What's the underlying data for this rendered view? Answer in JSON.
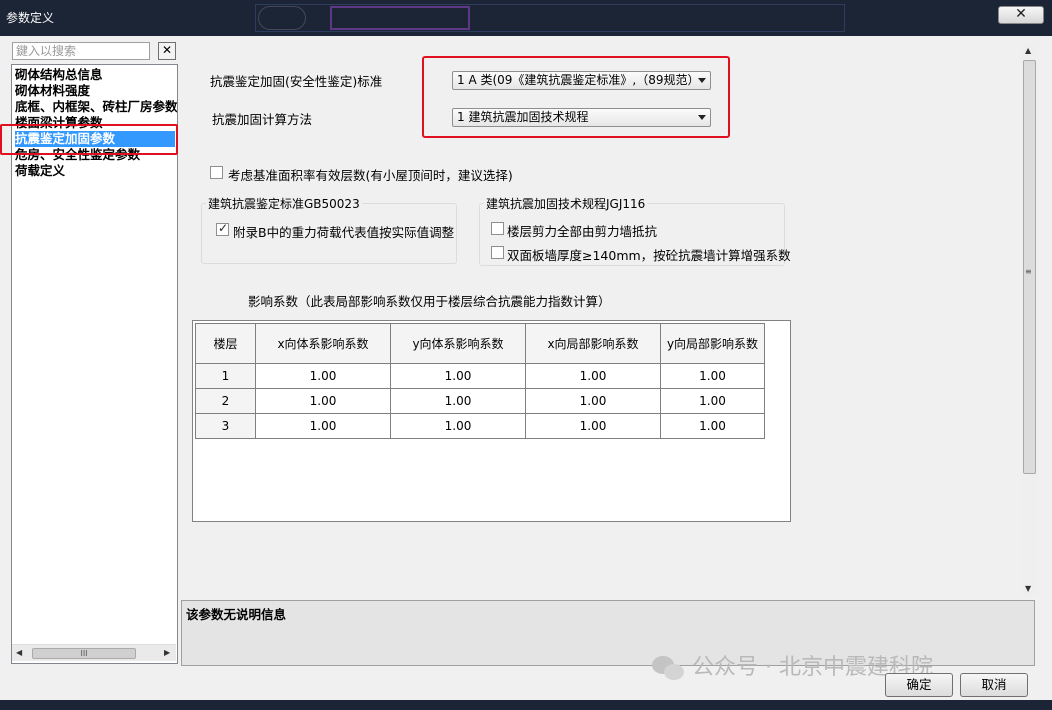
{
  "window": {
    "title": "参数定义",
    "close_label": "✕"
  },
  "search": {
    "placeholder": "鍵入以搜索",
    "clear_label": "✕"
  },
  "tree": {
    "items": [
      {
        "label": "砌体结构总信息",
        "selected": false
      },
      {
        "label": "砌体材料强度",
        "selected": false
      },
      {
        "label": "底框、内框架、砖柱厂房参数",
        "selected": false
      },
      {
        "label": "楼面梁计算参数",
        "selected": false
      },
      {
        "label": "抗震鉴定加固参数",
        "selected": true
      },
      {
        "label": "危房、安全性鉴定参数",
        "selected": false
      },
      {
        "label": "荷载定义",
        "selected": false
      }
    ],
    "scroll_grip": "III"
  },
  "form": {
    "standard_label": "抗震鉴定加固(安全性鉴定)标准",
    "standard_value": "1 A 类(09《建筑抗震鉴定标准》,（89规范）",
    "method_label": "抗震加固计算方法",
    "method_value": "1 建筑抗震加固技术规程",
    "consider_area_label": "考虑基准面积率有效层数(有小屋顶间时，建议选择)",
    "group_gb": {
      "title": "建筑抗震鉴定标准GB50023",
      "gravity_label": "附录B中的重力荷载代表值按实际值调整"
    },
    "group_jgj": {
      "title": "建筑抗震加固技术规程JGJ116",
      "shear_label": "楼层剪力全部由剪力墙抵抗",
      "double_label": "双面板墙厚度≥140mm，按砼抗震墙计算增强系数"
    },
    "coef_title": "影响系数（此表局部影响系数仅用于楼层综合抗震能力指数计算）"
  },
  "table": {
    "headers": [
      "楼层",
      "x向体系影响系数",
      "y向体系影响系数",
      "x向局部影响系数",
      "y向局部影响系数"
    ],
    "rows": [
      [
        "1",
        "1.00",
        "1.00",
        "1.00",
        "1.00"
      ],
      [
        "2",
        "1.00",
        "1.00",
        "1.00",
        "1.00"
      ],
      [
        "3",
        "1.00",
        "1.00",
        "1.00",
        "1.00"
      ]
    ]
  },
  "description": "该参数无说明信息",
  "buttons": {
    "ok": "确定",
    "cancel": "取消"
  },
  "watermark": "公众号 · 北京中震建科院",
  "colors": {
    "selection": "#3399ff",
    "highlight_red": "#e01020"
  }
}
